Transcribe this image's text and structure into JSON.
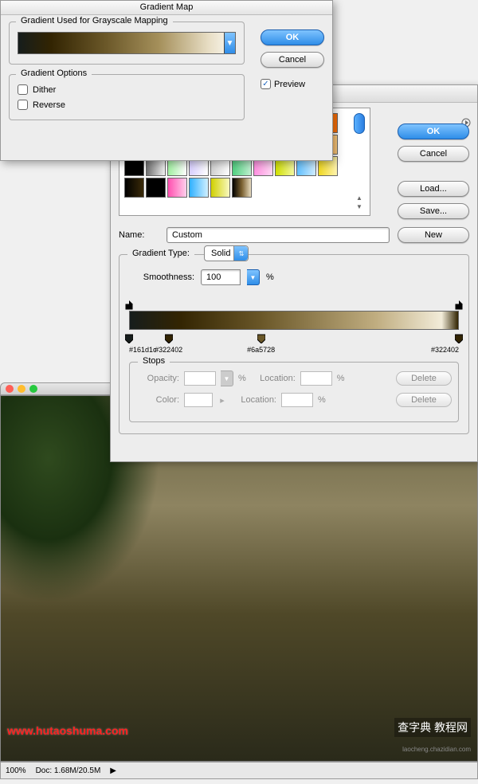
{
  "gradientMap": {
    "title": "Gradient Map",
    "mappingLegend": "Gradient Used for Grayscale Mapping",
    "optionsLegend": "Gradient Options",
    "dither": "Dither",
    "reverse": "Reverse",
    "okLabel": "OK",
    "cancelLabel": "Cancel",
    "previewLabel": "Preview",
    "previewChecked": true,
    "gradientCss": "linear-gradient(90deg, #161d1c 0%, #322402 15%, #6a5728 40%, #a5905b 65%, #e8dec5 88%, #fdfbf6 100%)"
  },
  "gradientEditor": {
    "okLabel": "OK",
    "cancelLabel": "Cancel",
    "loadLabel": "Load...",
    "saveLabel": "Save...",
    "newLabel": "New",
    "nameLabel": "Name:",
    "nameValue": "Custom",
    "typeLegend": "Gradient Type:",
    "typeValue": "Solid",
    "smoothLabel": "Smoothness:",
    "smoothValue": "100",
    "percent": "%",
    "stopsLegend": "Stops",
    "opacityLabel": "Opacity:",
    "colorLabel": "Color:",
    "locationLabel": "Location:",
    "deleteLabel": "Delete",
    "gradientCss": "linear-gradient(90deg, #161d1c 0%, #322402 15%, #6a5728 40%, #c0ad80 75%, #f2ecd9 95%, #322402 100%)",
    "colorStops": [
      {
        "hex": "#161d1c",
        "pos": 0
      },
      {
        "hex": "#322402",
        "pos": 12
      },
      {
        "hex": "#6a5728",
        "pos": 40
      },
      {
        "hex": "#322402",
        "pos": 100
      }
    ],
    "opacityStops": [
      {
        "pos": 0
      },
      {
        "pos": 100
      }
    ]
  },
  "presets": [
    "linear-gradient(90deg,#000,#fff)",
    "linear-gradient(90deg,#ff8a00,#ffe27a,#e02020)",
    "linear-gradient(90deg,#8f00ff,#ff9a00,#fff700)",
    "linear-gradient(90deg,#1a5ae0,#ff3030)",
    "linear-gradient(90deg,#1a5ae0,#ffe020,#1a5ae0)",
    "linear-gradient(90deg,#ff0000,#ff9a00,#ffff00,#00ff00,#0000ff,#8f00ff)",
    "linear-gradient(45deg,#fff 25%,#ff8 25%,#ff8 50%,#fff 50%,#fff 75%,#ff8 75%)",
    "radial-gradient(#fff,#fff)",
    "linear-gradient(90deg,#2060ff,#8f00ff,#ff0000)",
    "linear-gradient(90deg,#ffb347,#ff6a00)",
    "linear-gradient(90deg,#4a2c10,#c49a6c)",
    "linear-gradient(90deg,#b06040,#e8b898)",
    "linear-gradient(90deg,#000,#ff0000)",
    "linear-gradient(90deg,#8a9ac0,#fff,#dfe6f2)",
    "linear-gradient(90deg,#ff0000,#00ff00)",
    "linear-gradient(90deg,#ff0000,#ffff00,#00ff00,#00ffff,#0000ff,#ff00ff,#ff0000)",
    "repeating-linear-gradient(45deg,#000 0 4px,#fff 4px 8px)",
    "linear-gradient(90deg,#4a8050,#dfeee2)",
    "linear-gradient(90deg,#40a0ff,#ff8a30)",
    "linear-gradient(90deg,#ff8a30,#ffd080)",
    "linear-gradient(90deg,#000,#000)",
    "linear-gradient(90deg,#707070,#f0f0f0)",
    "linear-gradient(90deg,#a0f0a0,#fff)",
    "linear-gradient(90deg,#d8cfff,#fff)",
    "linear-gradient(90deg,#d0d0d0,#fff)",
    "linear-gradient(90deg,#50d080,#c0f0d0)",
    "linear-gradient(90deg,#ff90e0,#ffd8f4)",
    "linear-gradient(90deg,#d0e000,#f4f8a0)",
    "linear-gradient(90deg,#60c0ff,#d0ecff)",
    "linear-gradient(90deg,#f0d820,#fff4b0)",
    "linear-gradient(90deg,#000,#3a2a08)",
    "linear-gradient(90deg,#000,#000)",
    "linear-gradient(90deg,#ff50b0,#ffd0ec)",
    "linear-gradient(90deg,#30b0ff,#d0f0ff)",
    "linear-gradient(90deg,#d0d000,#f8f8c0)",
    "linear-gradient(90deg,#000,#7a6030,#e8dcc0)"
  ],
  "statusBar": {
    "zoom": "100%",
    "doc": "Doc: 1.68M/20.5M"
  },
  "watermarks": {
    "left": "www.hutaoshuma.com",
    "right": "查字典 教程网",
    "right2": "laocheng.chazidian.com"
  }
}
